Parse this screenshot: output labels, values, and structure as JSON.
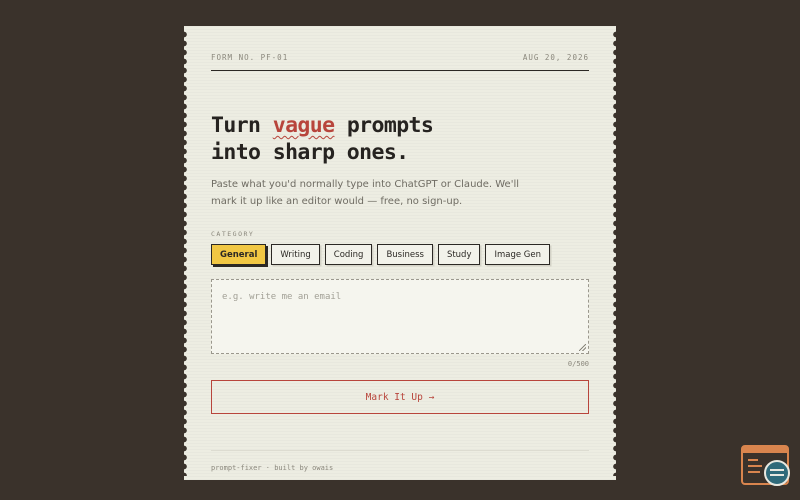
{
  "form": {
    "number": "FORM NO. PF-01",
    "date": "AUG 20, 2026"
  },
  "headline": {
    "part1": "Turn ",
    "accent": "vague",
    "part2": " prompts",
    "line2": "into sharp ones."
  },
  "subtitle": "Paste what you'd normally type into ChatGPT or Claude. We'll mark it up like an editor would — free, no sign-up.",
  "category": {
    "label": "CATEGORY",
    "selected": "General",
    "options": [
      "General",
      "Writing",
      "Coding",
      "Business",
      "Study",
      "Image Gen"
    ]
  },
  "prompt": {
    "value": "",
    "placeholder": "e.g. write me an email",
    "char_count": "0/500"
  },
  "submit_label": "Mark It Up →",
  "footer": "prompt-fixer · built by owais",
  "colors": {
    "background": "#3a322b",
    "paper": "#edede2",
    "ink": "#262320",
    "accent_red": "#b8453c",
    "chip_active": "#f1c743",
    "badge_orange": "#d9854e",
    "badge_teal": "#2f6a7a"
  },
  "icons": {
    "corner_badge": "browser-window-search-icon"
  }
}
